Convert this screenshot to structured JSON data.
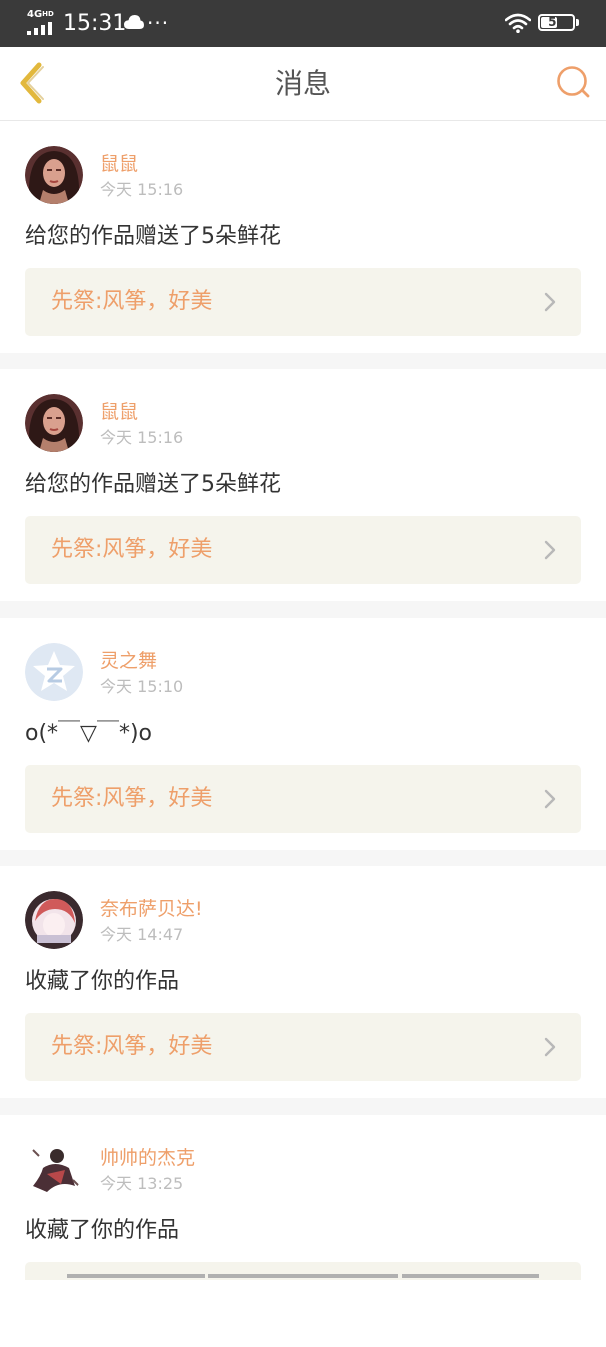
{
  "status_bar": {
    "network": "4G",
    "network_sub": "HD",
    "time": "15:31",
    "battery": "50",
    "battery_level": 0.5,
    "icons": [
      "signal-icon",
      "cloud-icon",
      "more-dots-icon",
      "wifi-icon",
      "battery-icon"
    ]
  },
  "header": {
    "title": "消息",
    "back_icon": "chevron-left-icon",
    "search_icon": "search-icon",
    "accent_color": "#ee9f6a",
    "back_color": "#e2b83c"
  },
  "messages": [
    {
      "user": "鼠鼠",
      "time": "今天 15:16",
      "content": "给您的作品赠送了5朵鲜花",
      "work": "先祭:风筝，好美",
      "avatar": "photo"
    },
    {
      "user": "鼠鼠",
      "time": "今天 15:16",
      "content": "给您的作品赠送了5朵鲜花",
      "work": "先祭:风筝，好美",
      "avatar": "photo"
    },
    {
      "user": "灵之舞",
      "time": "今天 15:10",
      "content": "o(*￣▽￣*)o",
      "work": "先祭:风筝，好美",
      "avatar": "qzone-default"
    },
    {
      "user": "奈布萨贝达!",
      "time": "今天 14:47",
      "content": "收藏了你的作品",
      "work": "先祭:风筝，好美",
      "avatar": "anime"
    },
    {
      "user": "帅帅的杰克",
      "time": "今天 13:25",
      "content": "收藏了你的作品",
      "work": "",
      "avatar": "figure"
    }
  ]
}
